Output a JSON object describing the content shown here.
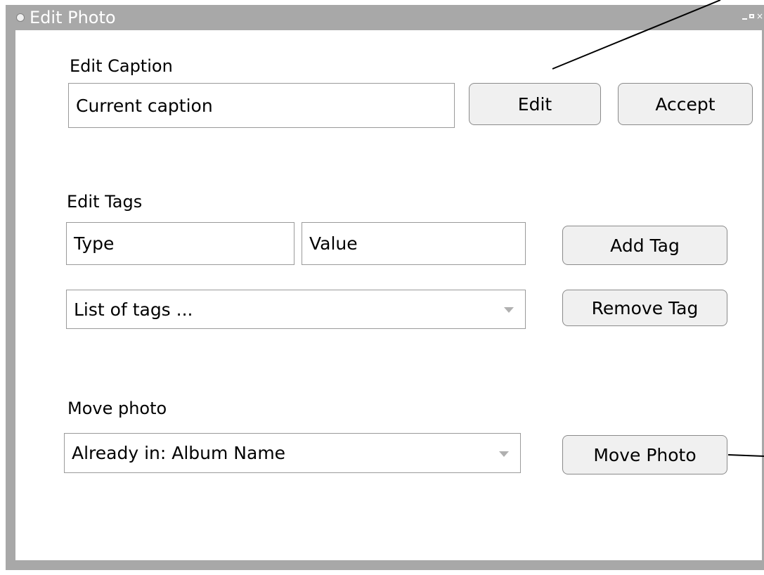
{
  "window": {
    "title": "Edit Photo"
  },
  "caption": {
    "heading": "Edit Caption",
    "value": "Current caption",
    "edit_label": "Edit",
    "accept_label": "Accept"
  },
  "tags": {
    "heading": "Edit Tags",
    "type_value": "Type",
    "value_value": "Value",
    "add_label": "Add Tag",
    "list_selected": "List of tags ...",
    "remove_label": "Remove Tag"
  },
  "move": {
    "heading": "Move photo",
    "album_selected": "Already in: Album Name",
    "move_label": "Move Photo"
  },
  "colors": {
    "frame": "#a8a8a8",
    "button_bg": "#f0f0f0",
    "border": "#9a9a9a"
  }
}
